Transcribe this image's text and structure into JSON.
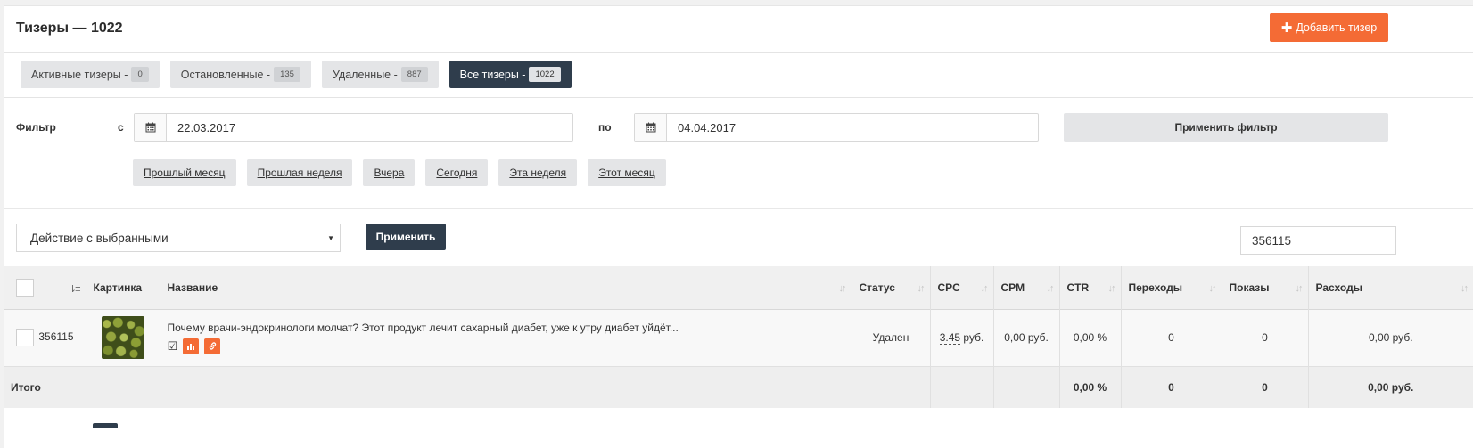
{
  "header": {
    "title": "Тизеры — 1022",
    "add_button": "Добавить тизер"
  },
  "tabs": [
    {
      "label": "Активные тизеры -",
      "count": "0",
      "active": false
    },
    {
      "label": "Остановленные -",
      "count": "135",
      "active": false
    },
    {
      "label": "Удаленные -",
      "count": "887",
      "active": false
    },
    {
      "label": "Все тизеры -",
      "count": "1022",
      "active": true
    }
  ],
  "filter": {
    "label": "Фильтр",
    "from_label": "с",
    "to_label": "по",
    "from_value": "22.03.2017",
    "to_value": "04.04.2017",
    "apply_label": "Применить фильтр",
    "quick_ranges": [
      "Прошлый месяц",
      "Прошлая неделя",
      "Вчера",
      "Сегодня",
      "Эта неделя",
      "Этот месяц"
    ]
  },
  "actions": {
    "select_value": "Действие с выбранными",
    "apply_label": "Применить",
    "search_value": "356115"
  },
  "table": {
    "columns": [
      "Картинка",
      "Название",
      "Статус",
      "CPC",
      "CPM",
      "CTR",
      "Переходы",
      "Показы",
      "Расходы"
    ],
    "rows": [
      {
        "id": "356115",
        "name": "Почему врачи-эндокринологи молчат? Этот продукт лечит сахарный диабет, уже к утру диабет уйдёт...",
        "status": "Удален",
        "cpc_value": "3.45",
        "cpc_unit": "руб.",
        "cpm": "0,00 руб.",
        "ctr": "0,00 %",
        "clicks": "0",
        "impressions": "0",
        "spend": "0,00 руб."
      }
    ],
    "total": {
      "label": "Итого",
      "ctr": "0,00 %",
      "clicks": "0",
      "impressions": "0",
      "spend": "0,00 руб."
    }
  },
  "icons": {
    "calendar": "calendar-icon",
    "plus": "plus-icon",
    "sort": "sort-icon",
    "check": "check-square-icon",
    "stats": "bar-chart-icon",
    "link": "link-icon"
  },
  "colors": {
    "accent": "#f46b35",
    "dark": "#2f3d4c"
  }
}
